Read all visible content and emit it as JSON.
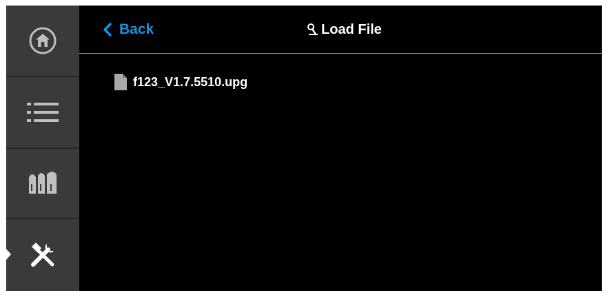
{
  "header": {
    "back_label": "Back",
    "title": "Load File"
  },
  "sidebar": {
    "items": [
      {
        "name": "home",
        "icon": "home-icon"
      },
      {
        "name": "list",
        "icon": "list-icon"
      },
      {
        "name": "inks",
        "icon": "ink-cartridges-icon"
      },
      {
        "name": "tools",
        "icon": "tools-icon",
        "active": true
      }
    ]
  },
  "files": [
    {
      "name": "f123_V1.7.5510.upg",
      "icon": "file-icon"
    }
  ],
  "colors": {
    "accent": "#1a8fe0",
    "background": "#000000",
    "sidebar": "#3a3a3a",
    "icon": "#bfbfbf"
  }
}
